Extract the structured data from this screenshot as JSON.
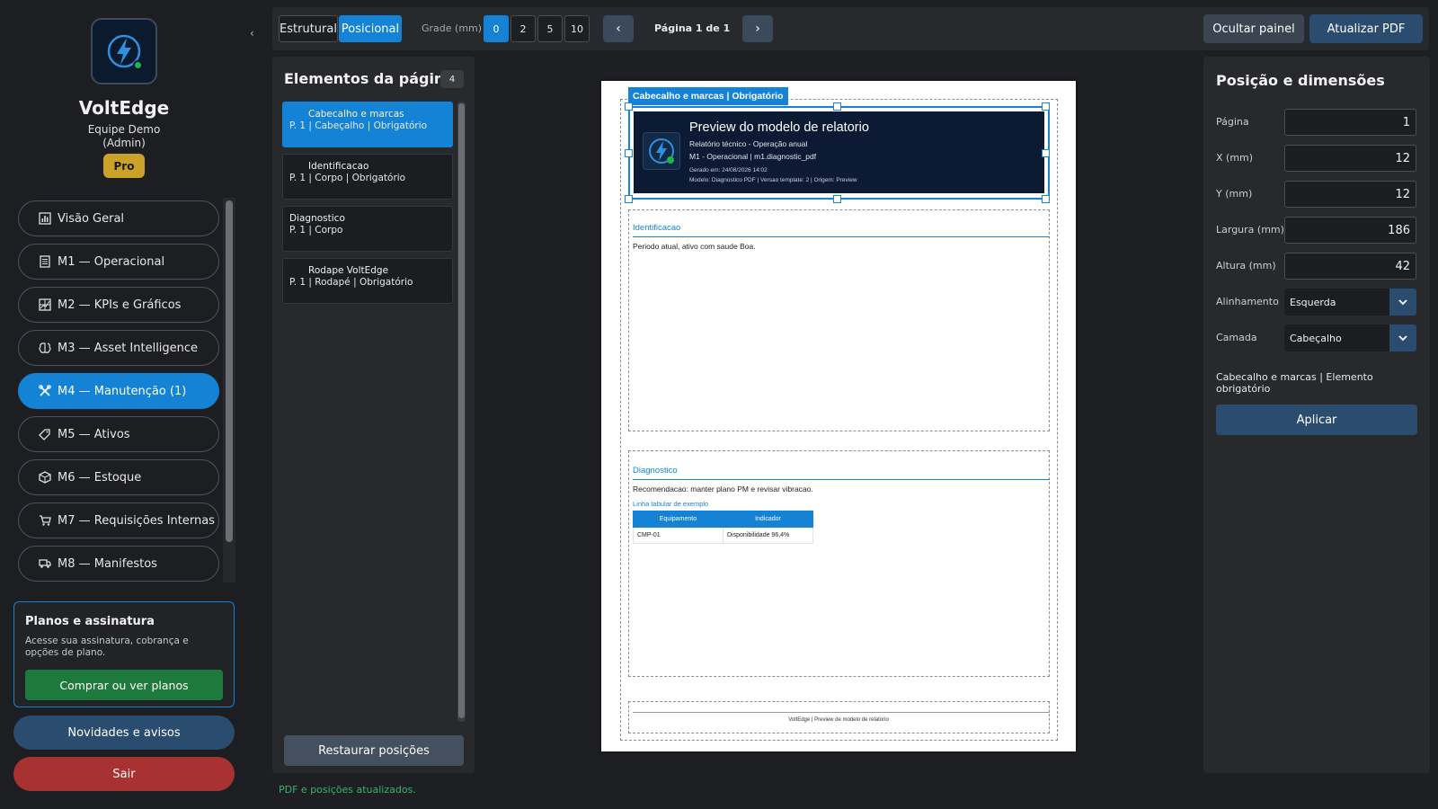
{
  "sidebar": {
    "collapse_icon": "‹",
    "brand_name": "VoltEdge",
    "team": "Equipe Demo",
    "role": "(Admin)",
    "plan_badge": "Pro",
    "nav": [
      {
        "label": "Visão Geral",
        "icon": "bar-chart-icon"
      },
      {
        "label": "M1 — Operacional",
        "icon": "document-icon"
      },
      {
        "label": "M2 — KPIs e Gráficos",
        "icon": "chart-grid-icon"
      },
      {
        "label": "M3 — Asset Intelligence",
        "icon": "brain-icon"
      },
      {
        "label": "M4 — Manutenção (1)",
        "icon": "tools-icon",
        "active": true
      },
      {
        "label": "M5 — Ativos",
        "icon": "tag-icon"
      },
      {
        "label": "M6 — Estoque",
        "icon": "box-icon"
      },
      {
        "label": "M7 — Requisições Internas",
        "icon": "cart-icon"
      },
      {
        "label": "M8 — Manifestos",
        "icon": "truck-icon"
      }
    ],
    "plans_card": {
      "title": "Planos e assinatura",
      "text": "Acesse sua assinatura, cobrança e opções de plano.",
      "button": "Comprar ou ver planos"
    },
    "news_button": "Novidades e avisos",
    "logout_button": "Sair"
  },
  "toolbar": {
    "mode_structural": "Estrutural",
    "mode_positional": "Posicional",
    "grid_label": "Grade (mm)",
    "grid_options": [
      "0",
      "2",
      "5",
      "10"
    ],
    "grid_selected": "0",
    "prev": "‹",
    "next": "›",
    "page_indicator": "Página 1 de 1",
    "hide_panel": "Ocultar painel",
    "refresh_pdf": "Atualizar PDF"
  },
  "elements_panel": {
    "title": "Elementos da página",
    "count": "4",
    "items": [
      {
        "name": "Cabecalho e marcas",
        "meta": "P. 1 | Cabeçalho | Obrigatório"
      },
      {
        "name": "Identificacao",
        "meta": "P. 1 | Corpo | Obrigatório"
      },
      {
        "name": "Diagnostico",
        "meta": "P. 1 | Corpo"
      },
      {
        "name": "Rodape VoltEdge",
        "meta": "P. 1 | Rodapé | Obrigatório"
      }
    ],
    "restore_button": "Restaurar posições",
    "status": "PDF e posições atualizados."
  },
  "preview": {
    "region_label": "Cabecalho e marcas | Obrigatório",
    "header_title": "Preview do modelo de relatorio",
    "header_line1": "Relatório técnico - Operação anual",
    "header_line2": "M1 - Operacional | m1.diagnostic_pdf",
    "header_line3": "Gerado em: 24/08/2026 14:02",
    "header_line4": "Modelo: Diagnostico PDF | Versao template: 2 | Origem: Preview",
    "ident_title": "Identificacao",
    "ident_text": "Periodo atual, ativo com saude Boa.",
    "diag_title": "Diagnostico",
    "diag_text": "Recomendacao: manter plano PM e revisar vibracao.",
    "table_caption": "Linha tabular de exemplo",
    "table_headers": [
      "Equipamento",
      "Indicador"
    ],
    "table_row": [
      "CMP-01",
      "Disponibilidade 96,4%"
    ],
    "footer_text": "VoltEdge | Preview de modelo de relatorio"
  },
  "properties": {
    "title": "Posição e dimensões",
    "fields": [
      {
        "label": "Página",
        "value": "1"
      },
      {
        "label": "X (mm)",
        "value": "12"
      },
      {
        "label": "Y (mm)",
        "value": "12"
      },
      {
        "label": "Largura (mm)",
        "value": "186"
      },
      {
        "label": "Altura (mm)",
        "value": "42"
      }
    ],
    "align_label": "Alinhamento",
    "align_value": "Esquerda",
    "layer_label": "Camada",
    "layer_value": "Cabeçalho",
    "note": "Cabecalho e marcas | Elemento obrigatório",
    "apply_button": "Aplicar"
  },
  "colors": {
    "accent": "#1483d6",
    "background": "#1e1f22",
    "panel": "#27292d",
    "success": "#1e7a3c",
    "danger": "#a83232",
    "badge": "#c9a227"
  }
}
